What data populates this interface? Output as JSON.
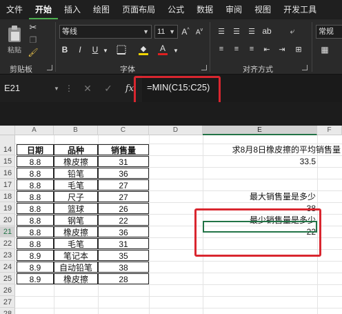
{
  "tabs": [
    "文件",
    "开始",
    "插入",
    "绘图",
    "页面布局",
    "公式",
    "数据",
    "审阅",
    "视图",
    "开发工具"
  ],
  "active_tab": "开始",
  "ribbon": {
    "clipboard_label": "剪贴板",
    "paste_label": "粘贴",
    "font_label": "字体",
    "align_label": "对齐方式",
    "font_name": "等线",
    "font_size": "11",
    "number_format": "常规",
    "bold": "B",
    "italic": "I",
    "underline": "U",
    "font_color_letter": "A"
  },
  "formula_bar": {
    "name_box": "E21",
    "fx": "fx",
    "formula": "=MIN(C15:C25)"
  },
  "columns": [
    "A",
    "B",
    "C",
    "D",
    "E",
    "F"
  ],
  "row_numbers": [
    "14",
    "15",
    "16",
    "17",
    "18",
    "19",
    "20",
    "21",
    "22",
    "23",
    "24",
    "25",
    "26",
    "27",
    "28"
  ],
  "selected_cell": "E21",
  "table": {
    "headers": [
      "日期",
      "品种",
      "销售量"
    ],
    "rows": [
      [
        "8.8",
        "橡皮擦",
        "31"
      ],
      [
        "8.8",
        "铅笔",
        "36"
      ],
      [
        "8.8",
        "毛笔",
        "27"
      ],
      [
        "8.8",
        "尺子",
        "27"
      ],
      [
        "8.8",
        "篮球",
        "26"
      ],
      [
        "8.8",
        "钢笔",
        "22"
      ],
      [
        "8.8",
        "橡皮擦",
        "36"
      ],
      [
        "8.8",
        "毛笔",
        "31"
      ],
      [
        "8.9",
        "笔记本",
        "35"
      ],
      [
        "8.9",
        "自动铅笔",
        "38"
      ],
      [
        "8.9",
        "橡皮擦",
        "28"
      ]
    ]
  },
  "side": {
    "q1": "求8月8日橡皮擦的平均销售量",
    "a1": "33.5",
    "q2": "最大销售量是多少",
    "a2": "38",
    "q3": "最少销售量是多少",
    "a3": "22"
  },
  "colors": {
    "highlight": "#d9262f",
    "selection": "#217346",
    "ribbon_bg": "#2a2a2a"
  }
}
